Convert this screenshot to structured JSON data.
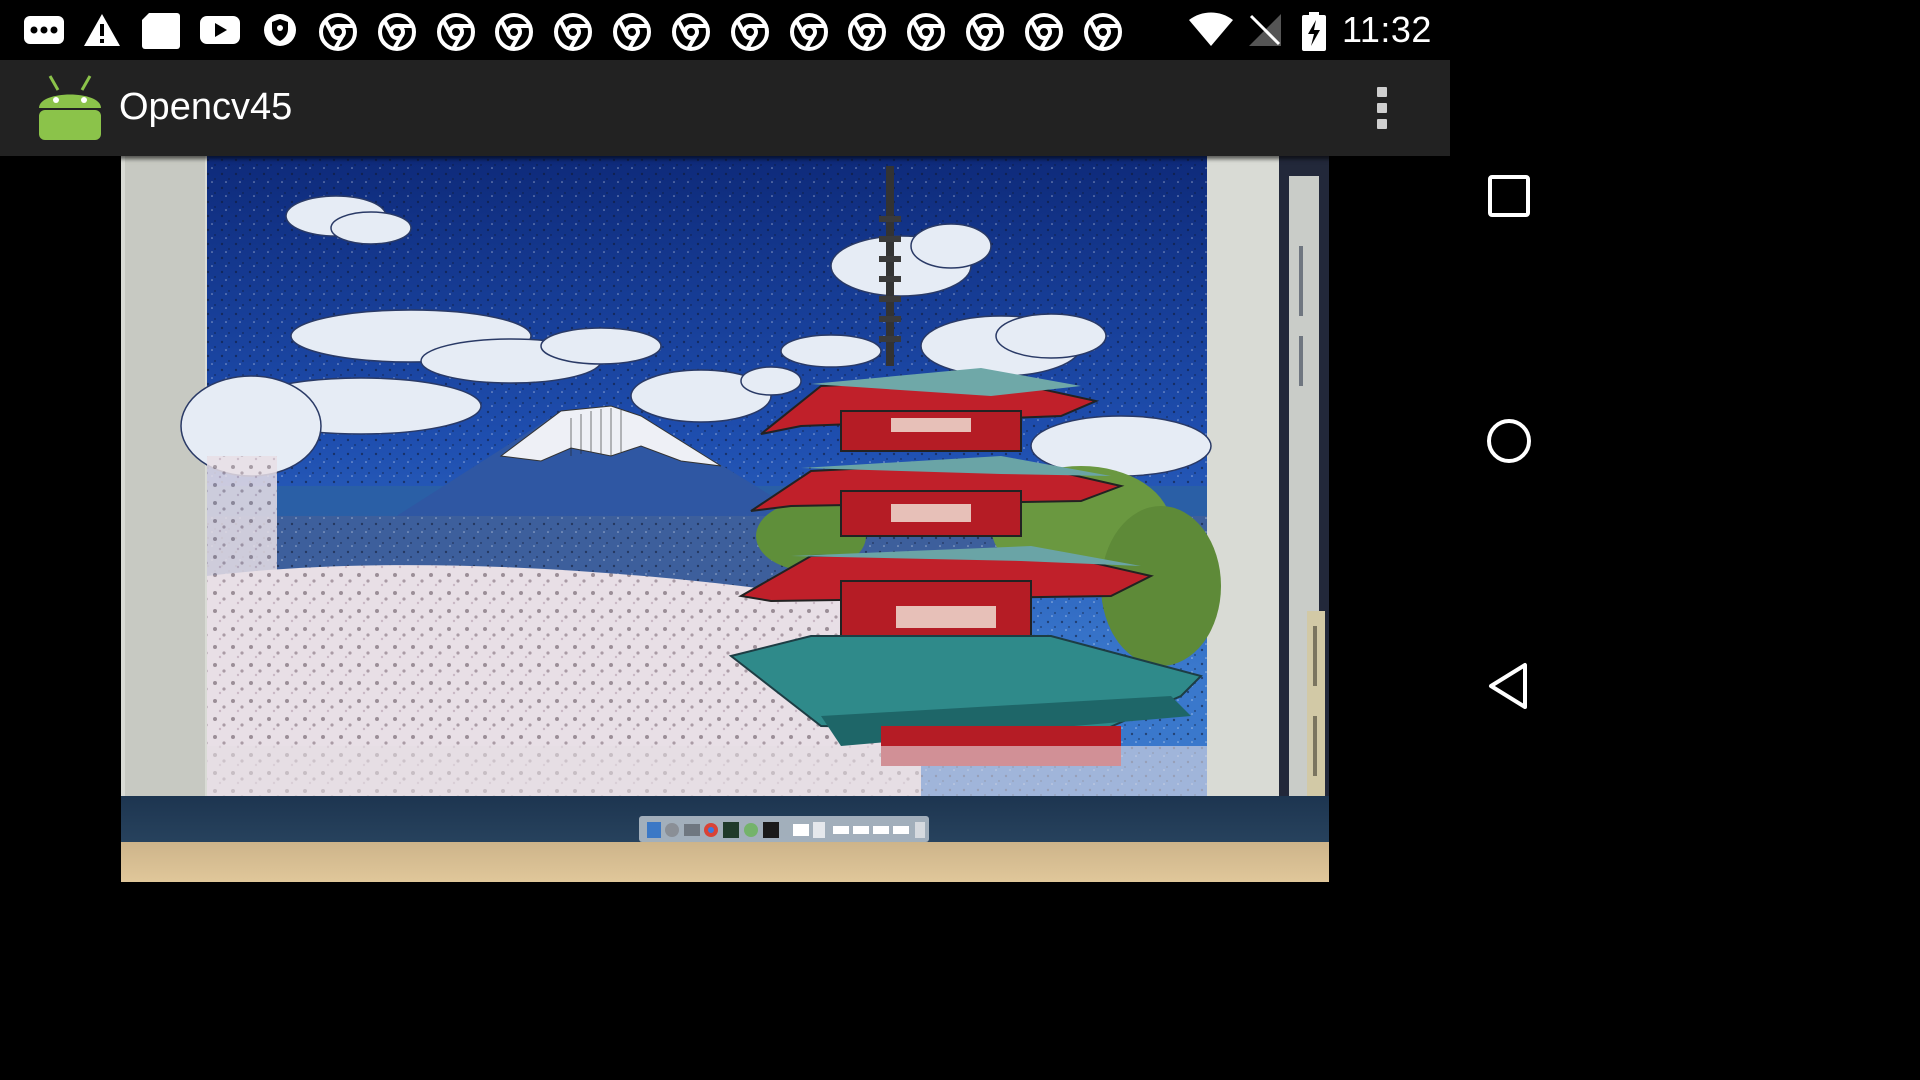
{
  "status_bar": {
    "notification_icons": [
      "chat-icon",
      "warning-icon",
      "sd-card-icon",
      "youtube-icon",
      "shield-icon",
      "chrome-icon",
      "chrome-icon",
      "chrome-icon",
      "chrome-icon",
      "chrome-icon",
      "chrome-icon",
      "chrome-icon",
      "chrome-icon",
      "chrome-icon",
      "chrome-icon",
      "chrome-icon",
      "chrome-icon",
      "chrome-icon",
      "chrome-icon"
    ],
    "system_icons": [
      "wifi-icon",
      "no-sim-icon",
      "battery-charging-icon"
    ],
    "time": "11:32"
  },
  "app_bar": {
    "title": "Opencv45",
    "icon": "android-icon",
    "menu_icon": "overflow-menu-icon"
  },
  "camera_preview": {
    "content": "camera-preview-image"
  },
  "nav_bar": {
    "buttons": [
      "recents-icon",
      "home-icon",
      "back-icon"
    ]
  },
  "colors": {
    "status_bar_bg": "#000000",
    "app_bar_bg": "#222222",
    "android_green": "#8BC34A",
    "sky_blue": "#1f4fb0",
    "pagoda_red": "#c0202a"
  }
}
